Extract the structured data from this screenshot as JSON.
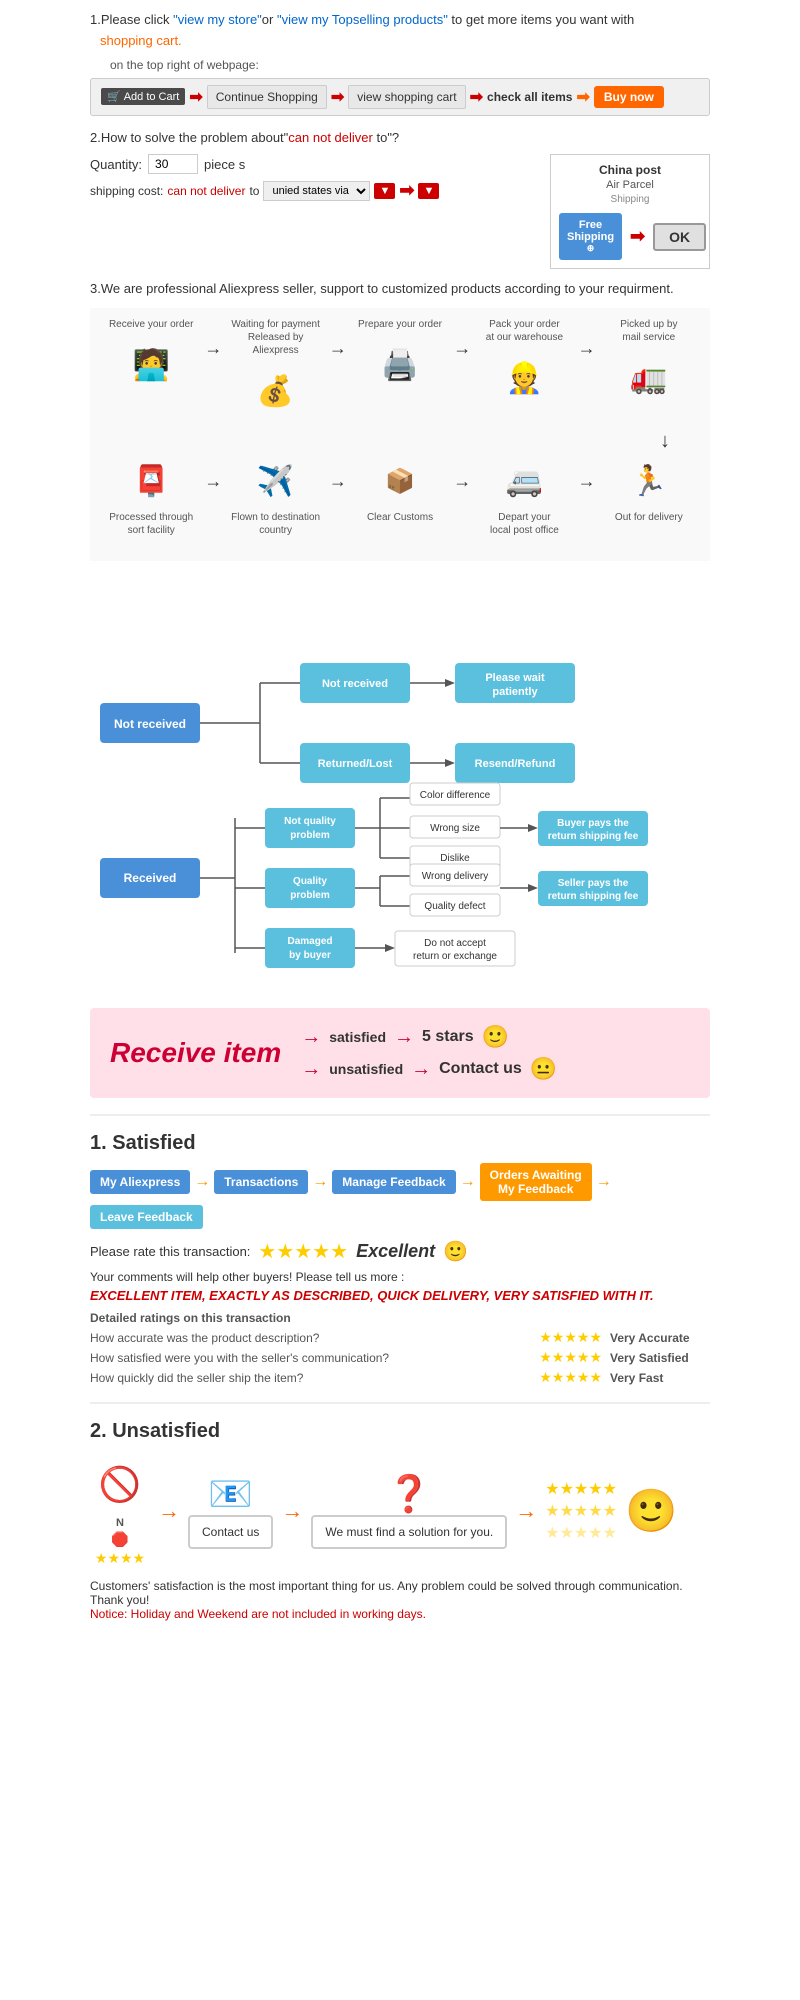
{
  "step1": {
    "text1": "1.Please click ",
    "link1": "\"view my store\"",
    "text2": "or ",
    "link2": "\"view my Topselling products\"",
    "text3": " to get more items you want with",
    "link3": "shopping cart.",
    "text4": "on the top right of webpage:",
    "cart": {
      "addToCart": "Add to Cart",
      "continueShopping": "Continue Shopping",
      "viewCart": "view shopping cart",
      "checkAll": "check all items",
      "buyNow": "Buy now"
    }
  },
  "step2": {
    "title": "2.How to solve the problem about\"",
    "canNotDeliver": "can not deliver",
    "titleEnd": " to\"?",
    "quantity_label": "Quantity:",
    "quantity_value": "30",
    "piece": "piece s",
    "shipping_label": "shipping cost:",
    "can_not": "can not deliver",
    "to": " to ",
    "via": "unied states via",
    "chinaPost": "China post",
    "airParcel": "Air Parcel",
    "freeShipping": "Free",
    "shipping": "Shipping",
    "shippingNote": "⊕",
    "ok": "OK"
  },
  "step3": {
    "text": "3.We are professional Aliexpress seller, support to customized products according to your requirment.",
    "flow": {
      "steps1": [
        {
          "label": "Receive your order",
          "icon": "🧑‍💻"
        },
        {
          "label": "Waiting for payment\nReleased by Aliexpress",
          "icon": "💰"
        },
        {
          "label": "Prepare your order",
          "icon": "🖨️"
        },
        {
          "label": "Pack your order\nat our warehouse",
          "icon": "👷"
        },
        {
          "label": "Picked up by\nmail service",
          "icon": "🚛"
        }
      ],
      "steps2": [
        {
          "label": "Out for delivery",
          "icon": "🏃"
        },
        {
          "label": "Depart your\nlocal post office",
          "icon": "🚐"
        },
        {
          "label": "Clear Customs",
          "icon": "📦"
        },
        {
          "label": "Flown to destination\ncountry",
          "icon": "✈️"
        },
        {
          "label": "Processed through\nsort facility",
          "icon": "📮"
        }
      ]
    }
  },
  "problemChart": {
    "notReceived": "Not received",
    "notReceived_sub1": "Not received",
    "notReceived_sub1_result": "Please wait patiently",
    "notReceived_sub2": "Returned/Lost",
    "notReceived_sub2_result": "Resend/Refund",
    "received": "Received",
    "received_sub1": "Not quality\nproblem",
    "received_sub1_options": [
      "Color difference",
      "Wrong size",
      "Dislike"
    ],
    "received_sub1_result": "Buyer pays the\nreturn shipping fee",
    "received_sub2": "Quality\nproblem",
    "received_sub2_options": [
      "Wrong delivery",
      "Quality defect"
    ],
    "received_sub2_result": "Seller pays the\nreturn shipping fee",
    "received_sub3": "Damaged\nby buyer",
    "received_sub3_result": "Do not accept\nreturn or exchange"
  },
  "receiveItem": {
    "title": "Receive item",
    "satisfied": "satisfied",
    "unsatisfied": "unsatisfied",
    "stars": "5 stars",
    "contactUs": "Contact us",
    "smileyHappy": "🙂",
    "smileyNeutral": "😐"
  },
  "satisfied": {
    "header": "1. Satisfied",
    "nav": [
      {
        "label": "My Aliexpress"
      },
      {
        "label": "Transactions"
      },
      {
        "label": "Manage Feedback"
      },
      {
        "label": "Orders Awaiting\nMy Feedback",
        "highlight": true
      },
      {
        "label": "Leave Feedback"
      }
    ],
    "rateLabel": "Please rate this transaction:",
    "excellent": "Excellent",
    "smiley": "🙂",
    "comment1": "Your comments will help other buyers! Please tell us more :",
    "commentExample": "EXCELLENT ITEM, EXACTLY AS DESCRIBED, QUICK DELIVERY, VERY SATISFIED WITH IT.",
    "detailsHeader": "Detailed ratings on this transaction",
    "ratings": [
      {
        "label": "How accurate was the product description?",
        "result": "Very Accurate"
      },
      {
        "label": "How satisfied were you with the seller's communication?",
        "result": "Very Satisfied"
      },
      {
        "label": "How quickly did the seller ship the item?",
        "result": "Very Fast"
      }
    ]
  },
  "unsatisfied": {
    "header": "2. Unsatisfied",
    "steps": [
      {
        "icon": "🚫",
        "sub": "N\n⭐"
      },
      {
        "icon": "📧"
      },
      {
        "icon": "❓"
      },
      {
        "icon": "⭐"
      }
    ],
    "contactLabel": "Contact us",
    "mustFind": "We must find a solution for you.",
    "footer1": "Customers' satisfaction is the most important thing for us. Any problem could be solved through communication. Thank you!",
    "notice": "Notice: Holiday and Weekend are not included in working days."
  },
  "icons": {
    "cart": "🛒",
    "arrow_right": "➡",
    "arrow_down": "↓",
    "star": "★",
    "star_empty": "☆"
  }
}
